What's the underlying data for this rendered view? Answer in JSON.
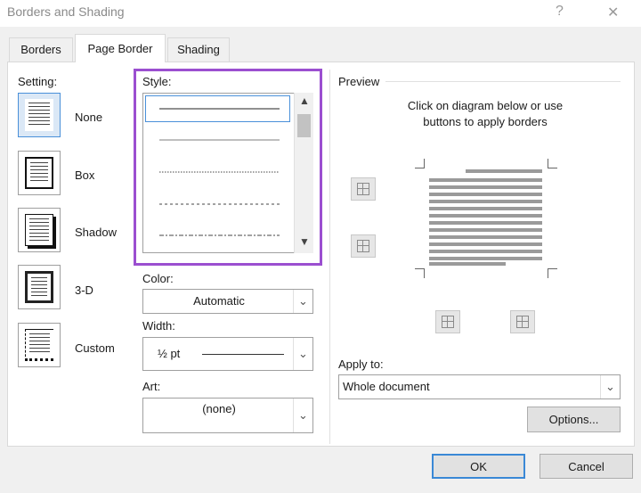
{
  "window": {
    "title": "Borders and Shading",
    "help_glyph": "?",
    "close_glyph": "✕"
  },
  "tabs": [
    {
      "label": "Borders",
      "active": false
    },
    {
      "label": "Page Border",
      "active": true
    },
    {
      "label": "Shading",
      "active": false
    }
  ],
  "setting": {
    "label": "Setting:",
    "options": [
      {
        "label": "None",
        "icon": "setting-none-icon",
        "selected": true
      },
      {
        "label": "Box",
        "icon": "setting-box-icon",
        "selected": false
      },
      {
        "label": "Shadow",
        "icon": "setting-shadow-icon",
        "selected": false
      },
      {
        "label": "3-D",
        "icon": "setting-3d-icon",
        "selected": false
      },
      {
        "label": "Custom",
        "icon": "setting-custom-icon",
        "selected": false
      }
    ]
  },
  "style": {
    "label": "Style:",
    "options": [
      "solid",
      "solid-light",
      "dotted",
      "dashed-small",
      "dash-dot"
    ],
    "selected": "solid"
  },
  "color": {
    "label": "Color:",
    "value": "Automatic"
  },
  "width": {
    "label": "Width:",
    "value": "½ pt"
  },
  "art": {
    "label": "Art:",
    "value": "(none)"
  },
  "preview": {
    "label": "Preview",
    "instructions": "Click on diagram below or use\nbuttons to apply borders"
  },
  "apply_to": {
    "label": "Apply to:",
    "value": "Whole document"
  },
  "buttons": {
    "options": "Options...",
    "ok": "OK",
    "cancel": "Cancel"
  },
  "colors": {
    "highlight_border": "#9b4fd0",
    "selection_blue": "#4a90d9"
  }
}
